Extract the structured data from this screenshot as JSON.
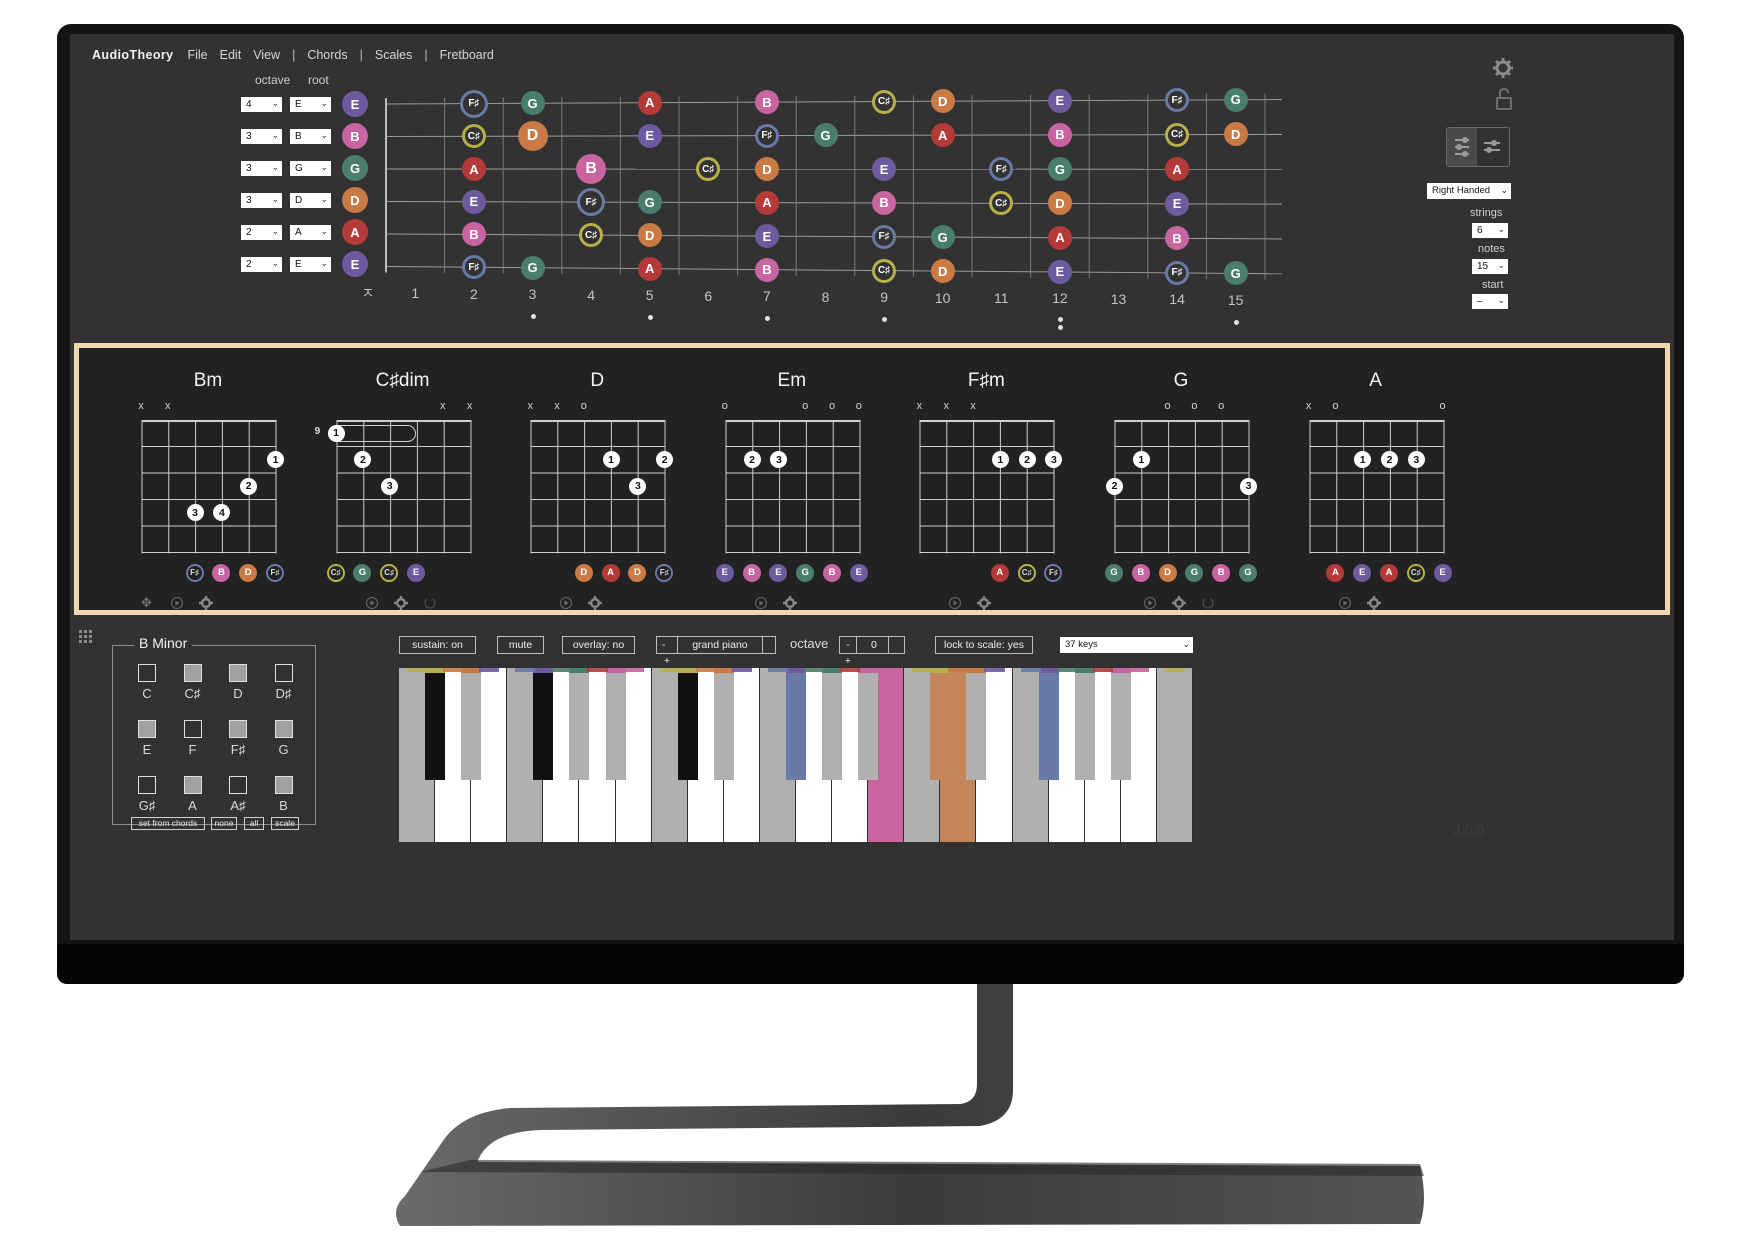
{
  "app": {
    "brand": "AudioTheory",
    "version": "3.0.0"
  },
  "menu": [
    {
      "label": "File"
    },
    {
      "label": "Edit"
    },
    {
      "label": "View"
    },
    {
      "sep": "|"
    },
    {
      "label": "Chords"
    },
    {
      "sep": "|"
    },
    {
      "label": "Scales"
    },
    {
      "sep": "|"
    },
    {
      "label": "Fretboard"
    }
  ],
  "tuning": {
    "octave_label": "octave",
    "root_label": "root",
    "strings": [
      {
        "octave": "4",
        "root": "E",
        "note": "E"
      },
      {
        "octave": "3",
        "root": "B",
        "note": "B"
      },
      {
        "octave": "3",
        "root": "G",
        "note": "G"
      },
      {
        "octave": "3",
        "root": "D",
        "note": "D"
      },
      {
        "octave": "2",
        "root": "A",
        "note": "A"
      },
      {
        "octave": "2",
        "root": "E",
        "note": "E"
      }
    ]
  },
  "note_colors": {
    "E": "#6e5a9e",
    "B": "#c8649f",
    "G": "#4b7d6b",
    "D": "#c97a45",
    "A": "#b43a3a",
    "F♯": "#6a7aa6",
    "C♯": "#b7b04a"
  },
  "fretboard": {
    "nut_symbol": "ㅈ",
    "fret_numbers": [
      "1",
      "2",
      "3",
      "4",
      "5",
      "6",
      "7",
      "8",
      "9",
      "10",
      "11",
      "12",
      "13",
      "14",
      "15"
    ],
    "inlay_frets": [
      3,
      5,
      7,
      9,
      12,
      15
    ],
    "double_inlay_fret": 12,
    "notes": [
      [
        [
          2,
          "F♯",
          "ring",
          1
        ],
        [
          3,
          "G"
        ],
        [
          5,
          "A"
        ],
        [
          7,
          "B"
        ],
        [
          9,
          "C♯",
          "ring"
        ],
        [
          10,
          "D"
        ],
        [
          12,
          "E"
        ],
        [
          14,
          "F♯",
          "ring"
        ],
        [
          15,
          "G"
        ]
      ],
      [
        [
          2,
          "C♯",
          "ring"
        ],
        [
          3,
          "D",
          "big"
        ],
        [
          5,
          "E"
        ],
        [
          7,
          "F♯",
          "ring"
        ],
        [
          8,
          "G"
        ],
        [
          10,
          "A"
        ],
        [
          12,
          "B"
        ],
        [
          14,
          "C♯",
          "ring"
        ],
        [
          15,
          "D"
        ]
      ],
      [
        [
          2,
          "A"
        ],
        [
          4,
          "B",
          "big"
        ],
        [
          6,
          "C♯",
          "ring"
        ],
        [
          7,
          "D"
        ],
        [
          9,
          "E"
        ],
        [
          11,
          "F♯",
          "ring"
        ],
        [
          12,
          "G"
        ],
        [
          14,
          "A"
        ]
      ],
      [
        [
          2,
          "E"
        ],
        [
          4,
          "F♯",
          "ring",
          1
        ],
        [
          5,
          "G"
        ],
        [
          7,
          "A"
        ],
        [
          9,
          "B"
        ],
        [
          11,
          "C♯",
          "ring"
        ],
        [
          12,
          "D"
        ],
        [
          14,
          "E"
        ]
      ],
      [
        [
          2,
          "B"
        ],
        [
          4,
          "C♯",
          "ring"
        ],
        [
          5,
          "D"
        ],
        [
          7,
          "E"
        ],
        [
          9,
          "F♯",
          "ring"
        ],
        [
          10,
          "G"
        ],
        [
          12,
          "A"
        ],
        [
          14,
          "B"
        ]
      ],
      [
        [
          2,
          "F♯",
          "ring"
        ],
        [
          3,
          "G"
        ],
        [
          5,
          "A"
        ],
        [
          7,
          "B"
        ],
        [
          9,
          "C♯",
          "ring"
        ],
        [
          10,
          "D"
        ],
        [
          12,
          "E"
        ],
        [
          14,
          "F♯",
          "ring"
        ],
        [
          15,
          "G"
        ]
      ]
    ]
  },
  "right_panel": {
    "handedness": "Right Handed",
    "strings_label": "strings",
    "strings_value": "6",
    "notes_label": "notes",
    "notes_value": "15",
    "start_label": "start",
    "start_value": "–"
  },
  "chords": [
    {
      "name": "Bm",
      "markers": [
        [
          "x",
          0
        ],
        [
          "x",
          1
        ]
      ],
      "start_fret": "",
      "fingers": [
        [
          5,
          2,
          "1"
        ],
        [
          4,
          3,
          "2"
        ],
        [
          2,
          4,
          "3"
        ],
        [
          3,
          4,
          "4"
        ]
      ],
      "notes": [
        "F♯",
        "B",
        "D",
        "F♯"
      ],
      "notes_start": 2
    },
    {
      "name": "C♯dim",
      "markers": [
        [
          "x",
          4
        ],
        [
          "x",
          5
        ]
      ],
      "start_fret": "9",
      "barre": true,
      "fingers": [
        [
          0,
          1,
          "1"
        ],
        [
          1,
          2,
          "2"
        ],
        [
          2,
          3,
          "3"
        ]
      ],
      "notes": [
        "C♯",
        "G",
        "C♯",
        "E"
      ],
      "notes_start": 0
    },
    {
      "name": "D",
      "markers": [
        [
          "x",
          0
        ],
        [
          "x",
          1
        ],
        [
          "o",
          2
        ]
      ],
      "start_fret": "",
      "fingers": [
        [
          3,
          2,
          "1"
        ],
        [
          5,
          2,
          "2"
        ],
        [
          4,
          3,
          "3"
        ]
      ],
      "notes": [
        "D",
        "A",
        "D",
        "F♯"
      ],
      "notes_start": 2
    },
    {
      "name": "Em",
      "markers": [
        [
          "o",
          0
        ],
        [
          "o",
          3
        ],
        [
          "o",
          4
        ],
        [
          "o",
          5
        ]
      ],
      "start_fret": "",
      "fingers": [
        [
          1,
          2,
          "2"
        ],
        [
          2,
          2,
          "3"
        ]
      ],
      "notes": [
        "E",
        "B",
        "E",
        "G",
        "B",
        "E"
      ],
      "notes_start": 0
    },
    {
      "name": "F♯m",
      "markers": [
        [
          "x",
          0
        ],
        [
          "x",
          1
        ],
        [
          "x",
          2
        ]
      ],
      "start_fret": "",
      "fingers": [
        [
          3,
          2,
          "1"
        ],
        [
          4,
          2,
          "2"
        ],
        [
          5,
          2,
          "3"
        ]
      ],
      "notes": [
        "A",
        "C♯",
        "F♯"
      ],
      "notes_start": 3
    },
    {
      "name": "G",
      "markers": [
        [
          "o",
          2
        ],
        [
          "o",
          3
        ],
        [
          "o",
          4
        ]
      ],
      "start_fret": "",
      "fingers": [
        [
          1,
          2,
          "1"
        ],
        [
          0,
          3,
          "2"
        ],
        [
          5,
          3,
          "3"
        ]
      ],
      "notes": [
        "G",
        "B",
        "D",
        "G",
        "B",
        "G"
      ],
      "notes_start": 0
    },
    {
      "name": "A",
      "markers": [
        [
          "x",
          0
        ],
        [
          "o",
          1
        ],
        [
          "o",
          5
        ]
      ],
      "start_fret": "",
      "fingers": [
        [
          2,
          2,
          "1"
        ],
        [
          3,
          2,
          "2"
        ],
        [
          4,
          2,
          "3"
        ]
      ],
      "notes": [
        "A",
        "E",
        "A",
        "C♯",
        "E"
      ],
      "notes_start": 1
    }
  ],
  "scale": {
    "title": "B Minor",
    "notes": [
      {
        "label": "C",
        "on": false
      },
      {
        "label": "C♯",
        "on": true
      },
      {
        "label": "D",
        "on": true
      },
      {
        "label": "D♯",
        "on": false
      },
      {
        "label": "E",
        "on": true
      },
      {
        "label": "F",
        "on": false
      },
      {
        "label": "F♯",
        "on": true
      },
      {
        "label": "G",
        "on": true
      },
      {
        "label": "G♯",
        "on": false
      },
      {
        "label": "A",
        "on": true
      },
      {
        "label": "A♯",
        "on": false
      },
      {
        "label": "B",
        "on": true
      }
    ],
    "buttons": {
      "set_from_chords": "set from chords",
      "none": "none",
      "all": "all",
      "scale": "scale"
    }
  },
  "piano_controls": {
    "sustain": "sustain: on",
    "mute": "mute",
    "overlay": "overlay: no",
    "minus": "-",
    "instrument": "grand piano",
    "plus": "+",
    "octave_label": "octave",
    "octave_value": "0",
    "lock": "lock to scale: yes",
    "keys": "37 keys"
  },
  "piano": {
    "white_keys": [
      "C",
      "D",
      "E",
      "F",
      "G",
      "A",
      "B",
      "C",
      "D",
      "E",
      "F",
      "G",
      "A",
      "B",
      "C",
      "D",
      "E",
      "F",
      "G",
      "A",
      "B",
      "C"
    ],
    "white_state": [
      "g",
      "w",
      "w",
      "g",
      "w",
      "w",
      "w",
      "g",
      "w",
      "w",
      "g",
      "w",
      "w",
      "pink",
      "g",
      "orange",
      "w",
      "g",
      "w",
      "w",
      "w",
      "g"
    ],
    "black_keys": [
      {
        "after": 0,
        "state": "black",
        "top": "C♯"
      },
      {
        "after": 1,
        "state": "g",
        "top": "D♯"
      },
      {
        "after": 3,
        "state": "black",
        "top": "F♯"
      },
      {
        "after": 4,
        "state": "g",
        "top": "G♯"
      },
      {
        "after": 5,
        "state": "g",
        "top": "A♯"
      },
      {
        "after": 7,
        "state": "black",
        "top": "C♯"
      },
      {
        "after": 8,
        "state": "g",
        "top": "D♯"
      },
      {
        "after": 10,
        "state": "blue",
        "top": "F♯"
      },
      {
        "after": 11,
        "state": "g",
        "top": "G♯"
      },
      {
        "after": 12,
        "state": "g",
        "top": "A♯"
      },
      {
        "after": 14,
        "state": "orange",
        "top": "C♯"
      },
      {
        "after": 15,
        "state": "g",
        "top": "D♯"
      },
      {
        "after": 17,
        "state": "blue",
        "top": "F♯"
      },
      {
        "after": 18,
        "state": "g",
        "top": "G♯"
      },
      {
        "after": 19,
        "state": "g",
        "top": "A♯"
      }
    ],
    "strip_colors": [
      "#b7b04a",
      "#c97a45",
      "#6e5a9e",
      "#6a7aa6",
      "#4b7d6b",
      "#b43a3a",
      "#c8649f"
    ]
  }
}
